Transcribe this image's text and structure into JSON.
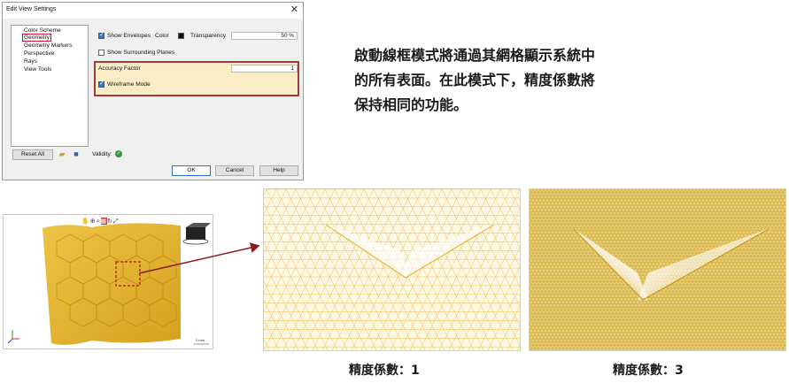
{
  "dialog": {
    "title": "Edit View Settings",
    "close_glyph": "✕",
    "tree_items": [
      "Color Scheme",
      "Geometry",
      "Geometry Markers",
      "Perspective",
      "Rays",
      "View Tools"
    ],
    "show_envelopes_label": "Show Envelopes",
    "color_label": "Color",
    "transparency_label": "Transparency",
    "transparency_value": "50 %",
    "show_surrounding_label": "Show Surrounding Planes",
    "accuracy_label": "Accuracy Factor",
    "accuracy_value": "1",
    "wireframe_label": "Wireframe Mode",
    "reset_label": "Reset All",
    "validity_label": "Validity:",
    "ok_label": "OK",
    "cancel_label": "Cancel",
    "help_label": "Help",
    "show_envelopes_checked": true,
    "show_surrounding_checked": false,
    "wireframe_checked": true
  },
  "description": {
    "line1": "啟動線框模式將通過其網格顯示系統中",
    "line2": "的所有表面。在此模式下，精度係數將",
    "line3": "保持相同的功能。"
  },
  "viewport": {
    "toolbar_icons": [
      "hand-icon",
      "zoom-window-icon",
      "zoom-icon",
      "fit-icon",
      "rotate-icon",
      "fullscreen-icon"
    ],
    "scale_label": "2 mm"
  },
  "captions": {
    "left": "精度係數：1",
    "right": "精度係數：3"
  },
  "colors": {
    "mesh_yellow": "#e8b830",
    "highlight_red": "#a33a3a",
    "arrow_red": "#8b1a1a",
    "accent_blue": "#3d77b8"
  }
}
